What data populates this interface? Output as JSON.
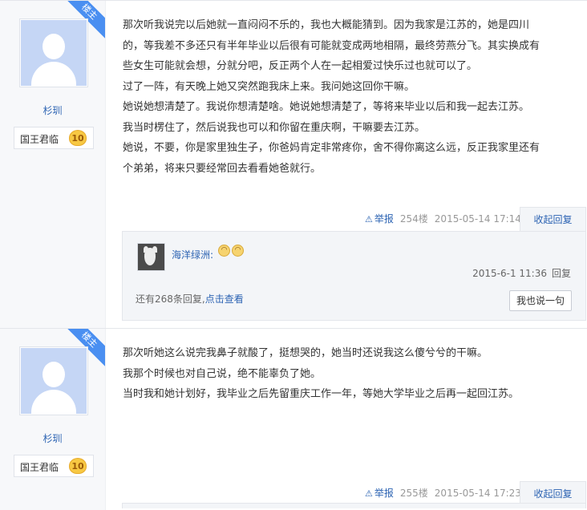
{
  "posts": [
    {
      "ribbon": "楼主",
      "username": "杉玔",
      "rank_name": "国王君临",
      "rank_level": "10",
      "lines": [
        "那次听我说完以后她就一直闷闷不乐的，我也大概能猜到。因为我家是江苏的，她是四川",
        "的，等我差不多还只有半年毕业以后很有可能就变成两地相隔，最终劳燕分飞。其实换成有",
        "些女生可能就会想，分就分吧，反正两个人在一起相爱过快乐过也就可以了。",
        "过了一阵，有天晚上她又突然跑我床上来。我问她这回你干嘛。",
        "她说她想清楚了。我说你想清楚啥。她说她想清楚了，等将来毕业以后和我一起去江苏。",
        "我当时楞住了，然后说我也可以和你留在重庆啊，干嘛要去江苏。",
        "她说，不要，你是家里独生子，你爸妈肯定非常疼你，舍不得你离这么远，反正我家里还有",
        "个弟弟，将来只要经常回去看看她爸就行。"
      ],
      "report": "举报",
      "floor": "254楼",
      "time": "2015-05-14 17:14",
      "toggle": "收起回复",
      "lzl": {
        "name": "海洋绿洲:",
        "time": "2015-6-1 11:36",
        "reply": "回复",
        "more_prefix": "还有268条回复,",
        "more_link": "点击查看",
        "say_button": "我也说一句"
      }
    },
    {
      "ribbon": "楼主",
      "username": "杉玔",
      "rank_name": "国王君临",
      "rank_level": "10",
      "lines": [
        "那次听她这么说完我鼻子就酸了，挺想哭的，她当时还说我这么傻兮兮的干嘛。",
        "我那个时候也对自己说，绝不能辜负了她。",
        "当时我和她计划好，我毕业之后先留重庆工作一年，等她大学毕业之后再一起回江苏。"
      ],
      "report": "举报",
      "floor": "255楼",
      "time": "2015-05-14 17:23",
      "toggle": "收起回复"
    }
  ],
  "icons": {
    "report": "warning-triangle-icon",
    "emoji": "smiley-icon"
  },
  "colors": {
    "link": "#2d64b3",
    "ribbon": "#4a8ff1",
    "sidebar": "#f7f8fa",
    "avatar": "#c5d6f5"
  }
}
